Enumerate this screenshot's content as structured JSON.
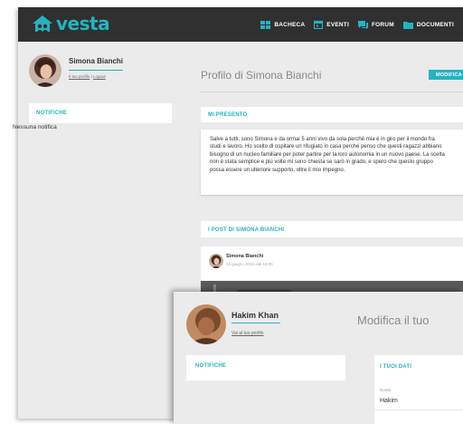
{
  "app": {
    "logo_text": "vesta",
    "accent": "#24b3c2"
  },
  "nav": [
    {
      "icon": "dashboard-icon",
      "label": "BACHECA"
    },
    {
      "icon": "calendar-icon",
      "label": "EVENTI"
    },
    {
      "icon": "forum-icon",
      "label": "FORUM"
    },
    {
      "icon": "folder-icon",
      "label": "DOCUMENTI"
    }
  ],
  "user": {
    "name": "Simona Bianchi",
    "profile_link": "Il tuo profilo",
    "separator": "|",
    "logout_link": "Logout"
  },
  "notifications": {
    "title": "NOTIFICHE",
    "empty": "Nessuna notifica"
  },
  "profile": {
    "title": "Profilo di Simona Bianchi",
    "edit_button": "MODIFICA"
  },
  "about": {
    "title": "MI PRESENTO",
    "text": "Salve a tutti, sono Simona e da ormai 5 anni vivo da sola perché mia è in giro per il mondo fra studi e lavoro. Ho scelto di ospitare un rifugiato in casa perché penso che questi ragazzi abbiano bisogno di un nucleo familiare per poter partire per la loro autonomia in un nuovo paese. La scelta non è stata semplice e più volte mi sono chiesta se sarò in grado, e spero che questo gruppo possa essere un ulteriore supporto, oltre il mio impegno."
  },
  "posts": {
    "title": "I POST DI SIMONA BIANCHI",
    "items": [
      {
        "author": "Simona Bianchi",
        "date": "23 giugno 2016 alle 15:05"
      }
    ]
  },
  "overlay": {
    "user_name": "Hakim Khan",
    "profile_link": "Vai al tuo profilo",
    "title": "Modifica il tuo",
    "notifications_title": "NOTIFICHE",
    "data_title": "I TUOI DATI",
    "field_label": "Nome",
    "field_value": "Hakim"
  }
}
